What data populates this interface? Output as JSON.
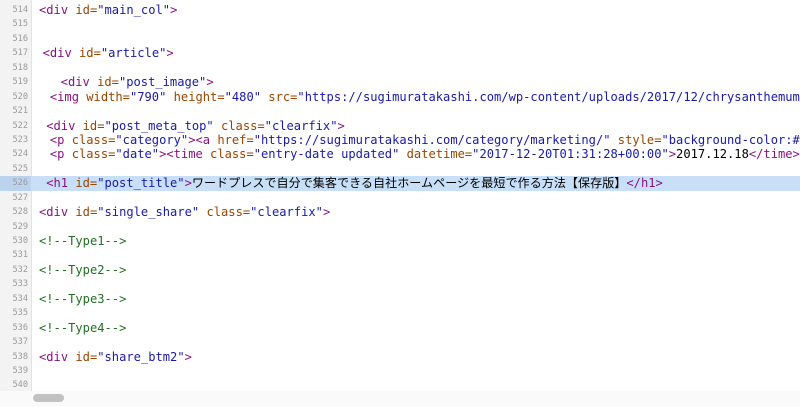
{
  "editor": {
    "lines": [
      {
        "num": "514",
        "indent": 0,
        "tokens": [
          {
            "t": "t",
            "v": "<div "
          },
          {
            "t": "a",
            "v": "id="
          },
          {
            "t": "s",
            "v": "\"main_col\""
          },
          {
            "t": "t",
            "v": ">"
          }
        ]
      },
      {
        "num": "515",
        "indent": 0,
        "tokens": []
      },
      {
        "num": "516",
        "indent": 0,
        "tokens": []
      },
      {
        "num": "517",
        "indent": 1,
        "tokens": [
          {
            "t": "t",
            "v": "<div "
          },
          {
            "t": "a",
            "v": "id="
          },
          {
            "t": "s",
            "v": "\"article\""
          },
          {
            "t": "t",
            "v": ">"
          }
        ]
      },
      {
        "num": "518",
        "indent": 0,
        "tokens": []
      },
      {
        "num": "519",
        "indent": 6,
        "tokens": [
          {
            "t": "t",
            "v": "<div "
          },
          {
            "t": "a",
            "v": "id="
          },
          {
            "t": "s",
            "v": "\"post_image\""
          },
          {
            "t": "t",
            "v": ">"
          }
        ]
      },
      {
        "num": "520",
        "indent": 3,
        "tokens": [
          {
            "t": "t",
            "v": "<img "
          },
          {
            "t": "a",
            "v": "width="
          },
          {
            "t": "s",
            "v": "\"790\""
          },
          {
            "t": "a",
            "v": " height="
          },
          {
            "t": "s",
            "v": "\"480\""
          },
          {
            "t": "a",
            "v": " src="
          },
          {
            "t": "s",
            "v": "\"https://sugimuratakashi.com/wp-content/uploads/2017/12/chrysanthemum"
          }
        ]
      },
      {
        "num": "521",
        "indent": 0,
        "tokens": []
      },
      {
        "num": "522",
        "indent": 2,
        "tokens": [
          {
            "t": "t",
            "v": "<div "
          },
          {
            "t": "a",
            "v": "id="
          },
          {
            "t": "s",
            "v": "\"post_meta_top\""
          },
          {
            "t": "a",
            "v": " class="
          },
          {
            "t": "s",
            "v": "\"clearfix\""
          },
          {
            "t": "t",
            "v": ">"
          }
        ]
      },
      {
        "num": "523",
        "indent": 3,
        "tokens": [
          {
            "t": "t",
            "v": "<p "
          },
          {
            "t": "a",
            "v": "class="
          },
          {
            "t": "s",
            "v": "\"category\""
          },
          {
            "t": "t",
            "v": "><a "
          },
          {
            "t": "a",
            "v": "href="
          },
          {
            "t": "s",
            "v": "\"https://sugimuratakashi.com/category/marketing/\""
          },
          {
            "t": "a",
            "v": " style="
          },
          {
            "t": "s",
            "v": "\"background-color:#"
          }
        ]
      },
      {
        "num": "524",
        "indent": 3,
        "tokens": [
          {
            "t": "t",
            "v": "<p "
          },
          {
            "t": "a",
            "v": "class="
          },
          {
            "t": "s",
            "v": "\"date\""
          },
          {
            "t": "t",
            "v": "><time "
          },
          {
            "t": "a",
            "v": "class="
          },
          {
            "t": "s",
            "v": "\"entry-date updated\""
          },
          {
            "t": "a",
            "v": " datetime="
          },
          {
            "t": "s",
            "v": "\"2017-12-20T01:31:28+00:00\""
          },
          {
            "t": "t",
            "v": ">"
          },
          {
            "t": "x",
            "v": "2017.12.18"
          },
          {
            "t": "t",
            "v": "</time>"
          }
        ]
      },
      {
        "num": "525",
        "indent": 0,
        "tokens": []
      },
      {
        "num": "526",
        "indent": 2,
        "highlight": true,
        "tokens": [
          {
            "t": "t",
            "v": "<h1 "
          },
          {
            "t": "a",
            "v": "id="
          },
          {
            "t": "s",
            "v": "\"post_title\""
          },
          {
            "t": "t",
            "v": ">"
          },
          {
            "t": "x",
            "v": "ワードプレスで自分で集客できる自社ホームページを最短で作る方法【保存版】"
          },
          {
            "t": "t",
            "v": "</h1>"
          }
        ]
      },
      {
        "num": "527",
        "indent": 0,
        "tokens": []
      },
      {
        "num": "528",
        "indent": 0,
        "tokens": [
          {
            "t": "t",
            "v": "<div "
          },
          {
            "t": "a",
            "v": "id="
          },
          {
            "t": "s",
            "v": "\"single_share\""
          },
          {
            "t": "a",
            "v": " class="
          },
          {
            "t": "s",
            "v": "\"clearfix\""
          },
          {
            "t": "t",
            "v": ">"
          }
        ]
      },
      {
        "num": "529",
        "indent": 0,
        "tokens": []
      },
      {
        "num": "530",
        "indent": 0,
        "tokens": [
          {
            "t": "c",
            "v": "<!--Type1-->"
          }
        ]
      },
      {
        "num": "531",
        "indent": 0,
        "tokens": []
      },
      {
        "num": "532",
        "indent": 0,
        "tokens": [
          {
            "t": "c",
            "v": "<!--Type2-->"
          }
        ]
      },
      {
        "num": "533",
        "indent": 0,
        "tokens": []
      },
      {
        "num": "534",
        "indent": 0,
        "tokens": [
          {
            "t": "c",
            "v": "<!--Type3-->"
          }
        ]
      },
      {
        "num": "535",
        "indent": 0,
        "tokens": []
      },
      {
        "num": "536",
        "indent": 0,
        "tokens": [
          {
            "t": "c",
            "v": "<!--Type4-->"
          }
        ]
      },
      {
        "num": "537",
        "indent": 0,
        "tokens": []
      },
      {
        "num": "538",
        "indent": 0,
        "tokens": [
          {
            "t": "t",
            "v": "<div "
          },
          {
            "t": "a",
            "v": "id="
          },
          {
            "t": "s",
            "v": "\"share_btm2\""
          },
          {
            "t": "t",
            "v": ">"
          }
        ]
      },
      {
        "num": "539",
        "indent": 0,
        "tokens": []
      },
      {
        "num": "540",
        "indent": 0,
        "tokens": []
      }
    ]
  },
  "colors": {
    "tag": "#881280",
    "attribute": "#994500",
    "string": "#1a1aa6",
    "comment": "#236e25",
    "highlight": "#c8dff8"
  }
}
